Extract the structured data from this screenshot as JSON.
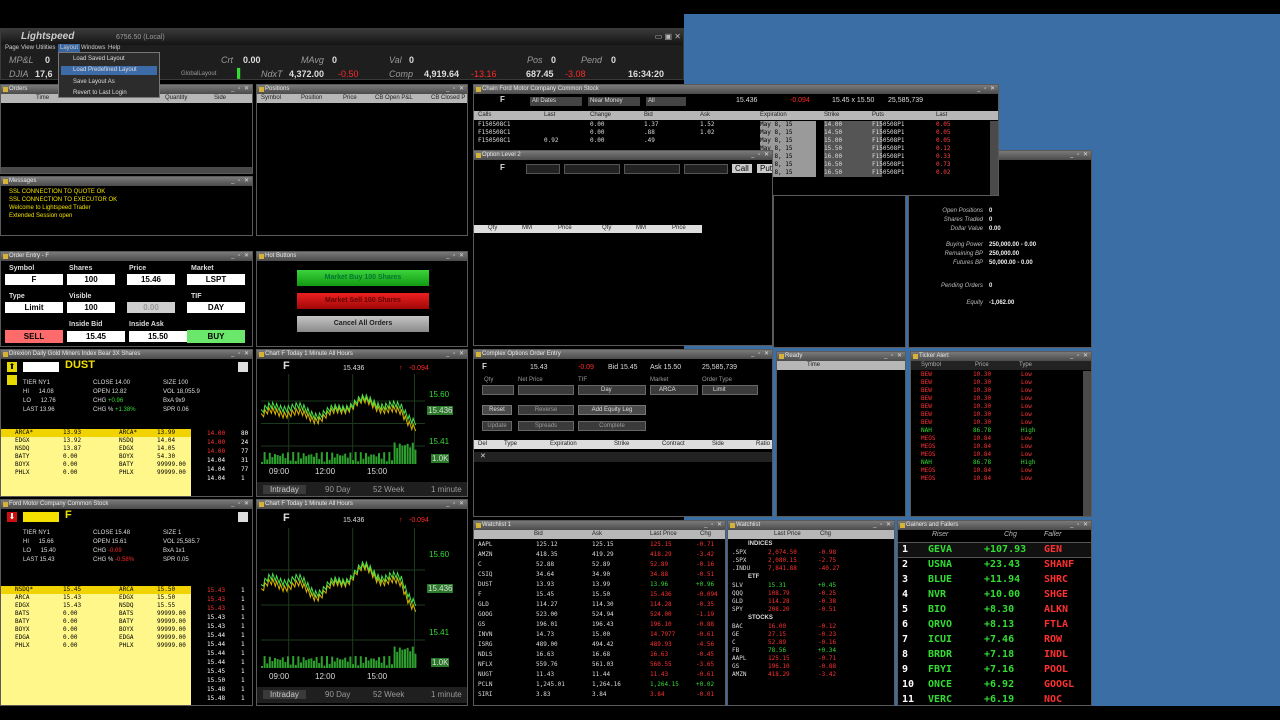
{
  "main": {
    "app_name": "Lightspeed",
    "account": "6756.50 (Local)",
    "menu": [
      "Page",
      "View",
      "Utilities",
      "Layout",
      "Windows",
      "Help"
    ],
    "layout_menu": [
      "Load Saved Layout",
      "Load Predefined Layout",
      "Save Layout As",
      "Revert to Last Login"
    ],
    "stats_row1": [
      {
        "label": "MP&L",
        "value": "0"
      },
      {
        "label": "Crt",
        "value": "0.00"
      },
      {
        "label": "MAvg",
        "value": "0"
      },
      {
        "label": "Val",
        "value": "0"
      },
      {
        "label": "Pos",
        "value": "0"
      },
      {
        "label": "Pend",
        "value": "0"
      }
    ],
    "stats_row2": {
      "dji_label": "DJIA",
      "dji_value": "17,6",
      "layout_label": "GlobalLayout",
      "nasdaq_label": "NdxT",
      "nasdaq_value": "4,372.00",
      "nasdaq_chg": "-0.50",
      "comp_label": "Comp",
      "comp_value": "4,919.64",
      "comp_chg": "-13.16",
      "val2": "687.45",
      "val2_chg": "-3.08",
      "clock": "16:34:20"
    }
  },
  "orders": {
    "title": "Orders",
    "cols": [
      "Time",
      "Quantity",
      "Side"
    ]
  },
  "positions": {
    "title": "Positions",
    "cols": [
      "Symbol",
      "Position",
      "Price",
      "CB Open P&L",
      "CB Closed P"
    ]
  },
  "messages": {
    "title": "Messages",
    "lines": [
      "SSL CONNECTION TO QUOTE OK",
      "SSL CONNECTION TO EXECUTOR OK",
      "Welcome to Lightspeed Trader",
      "Extended Session open"
    ]
  },
  "order_entry": {
    "title": "Order Entry - F",
    "labels": {
      "symbol": "Symbol",
      "shares": "Shares",
      "price": "Price",
      "market": "Market",
      "type": "Type",
      "visible": "Visible",
      "tif": "TIF",
      "inside_bid": "Inside Bid",
      "inside_ask": "Inside Ask"
    },
    "symbol": "F",
    "shares": "100",
    "price": "15.46",
    "market": "LSPT",
    "type": "Limit",
    "visible": "100",
    "stop": "0.00",
    "tif": "DAY",
    "bid": "15.45",
    "ask": "15.50",
    "sell": "SELL",
    "buy": "BUY"
  },
  "hot_buttons": {
    "title": "Hot Buttons",
    "b1": "Market Buy 100 Shares",
    "b2": "Market Sell 100 Shares",
    "b3": "Cancel All Orders"
  },
  "option_chain": {
    "title": "Chain Ford Motor Company Common Stock",
    "symbol": "F",
    "dates": "All Dates",
    "moneyness": "Near Money",
    "all": "All",
    "price": "15.436",
    "chg": "-0.094",
    "bidask": "15.45 x 15.50",
    "vol": "25,585,739",
    "cols": [
      "Calls",
      "Last",
      "Change",
      "Bid",
      "Ask",
      "Expiration",
      "Strike",
      "Puts",
      "Last"
    ],
    "rows": [
      [
        "F150508C1",
        "",
        "0.00",
        "1.37",
        "1.52",
        "May 8, 15",
        "14.00",
        "F150508P1",
        "0.05"
      ],
      [
        "F150508C1",
        "",
        "0.00",
        ".88",
        "1.02",
        "May 8, 15",
        "14.50",
        "F150508P1",
        "0.05"
      ],
      [
        "F150508C1",
        "0.92",
        "0.00",
        ".49",
        "",
        "May 8, 15",
        "15.00",
        "F150508P1",
        "0.05"
      ],
      [
        "",
        "",
        "",
        "",
        "",
        "May 8, 15",
        "15.50",
        "F150508P1",
        "0.12"
      ],
      [
        "",
        "",
        "",
        "",
        "",
        "May 8, 15",
        "16.00",
        "F150508P1",
        "0.33"
      ],
      [
        "",
        "",
        "",
        "",
        "",
        "May 8, 15",
        "16.50",
        "F150508P1",
        "0.73"
      ],
      [
        "",
        "",
        "",
        "",
        "",
        "May 8, 15",
        "16.50",
        "F150508P1",
        "0.02"
      ]
    ]
  },
  "option_level2": {
    "title": "Option Level 2",
    "sym": "F",
    "btns": [
      "Call",
      "Put"
    ],
    "cols": [
      "Qty",
      "MM",
      "Price",
      "Qty",
      "MM",
      "Price"
    ]
  },
  "account": {
    "rows": [
      {
        "l": "Open Positions",
        "v": "0"
      },
      {
        "l": "Shares Traded",
        "v": "0"
      },
      {
        "l": "Dollar Value",
        "v": "0.00"
      },
      {
        "l": "Buying Power",
        "v": "250,000.00 - 0.00"
      },
      {
        "l": "Remaining BP",
        "v": "250,000.00"
      },
      {
        "l": "Futures BP",
        "v": "50,000.00 - 0.00"
      },
      {
        "l": "Pending Orders",
        "v": "0"
      },
      {
        "l": "Equity",
        "v": "-1,062.00"
      }
    ]
  },
  "l2_dust": {
    "title": "Direxion Daily Gold Miners Index Bear 3X Shares",
    "symbol": "DUST",
    "tier": "NY1",
    "close": "14.00",
    "size": "100",
    "hi": "14.08",
    "open": "12.82",
    "vol": "18,055.9",
    "lo": "12.76",
    "chg": "+0.96",
    "bid": "9x9",
    "last": "13.96",
    "chgpct": "+1.38%",
    "spr": "0.06",
    "bids": [
      [
        "ARCA*",
        "13.93",
        "ARCA*",
        "13.99"
      ],
      [
        "EDGX",
        "13.92",
        "NSDQ",
        "14.04"
      ],
      [
        "NSDQ",
        "13.87",
        "EDGX",
        "14.05"
      ],
      [
        "BATY",
        "0.00",
        "BOYX",
        "54.30"
      ],
      [
        "BOYX",
        "0.00",
        "BATY",
        "99999.00"
      ],
      [
        "PHLX",
        "0.00",
        "PHLX",
        "99999.00"
      ]
    ],
    "prints": [
      [
        "14.00",
        "80"
      ],
      [
        "14.00",
        "24"
      ],
      [
        "14.00",
        "77"
      ],
      [
        "14.04",
        "31"
      ],
      [
        "14.04",
        "77"
      ],
      [
        "14.04",
        "1"
      ]
    ]
  },
  "l2_f": {
    "title": "Ford Motor Company Common Stock",
    "symbol": "F",
    "tier": "NY1",
    "close": "15.48",
    "size": "1",
    "hi": "15.66",
    "open": "15.61",
    "vol": "25,585.7",
    "lo": "15.40",
    "chg": "-0.09",
    "bid": "1x1",
    "last": "15.43",
    "chgpct": "-0.58%",
    "spr": "0.05",
    "bids": [
      [
        "NSDQ*",
        "15.45",
        "ARCA",
        "15.50"
      ],
      [
        "ARCA",
        "15.43",
        "EDGX",
        "15.50"
      ],
      [
        "EDGX",
        "15.43",
        "NSDQ",
        "15.55"
      ],
      [
        "BATS",
        "0.00",
        "BATS",
        "99999.00"
      ],
      [
        "BATY",
        "0.00",
        "BATY",
        "99999.00"
      ],
      [
        "BOYX",
        "0.00",
        "BOYX",
        "99999.00"
      ],
      [
        "EDGA",
        "0.00",
        "EDGA",
        "99999.00"
      ],
      [
        "PHLX",
        "0.00",
        "PHLX",
        "99999.00"
      ]
    ],
    "prints": [
      [
        "15.43",
        "1"
      ],
      [
        "15.43",
        "1"
      ],
      [
        "15.43",
        "1"
      ],
      [
        "15.43",
        "1"
      ],
      [
        "15.43",
        "1"
      ],
      [
        "15.44",
        "1"
      ],
      [
        "15.44",
        "1"
      ],
      [
        "15.44",
        "1"
      ],
      [
        "15.44",
        "1"
      ],
      [
        "15.45",
        "1"
      ],
      [
        "15.50",
        "1"
      ],
      [
        "15.48",
        "1"
      ],
      [
        "15.48",
        "1"
      ]
    ]
  },
  "chart1": {
    "title": "Chart F Today 1 Minute All Hours",
    "symbol": "F",
    "price": "15.436",
    "chg": "-0.094",
    "y_top": "15.60",
    "y_mid": "15.436",
    "y_bot": "15.41",
    "vol_label": "1.0K",
    "x": [
      "09:00",
      "12:00",
      "15:00"
    ],
    "tabs": [
      "Intraday",
      "90 Day",
      "52 Week",
      "1 minute"
    ]
  },
  "chart2": {
    "title": "Chart F Today 1 Minute All Hours",
    "symbol": "F",
    "price": "15.436",
    "chg": "-0.094",
    "y_top": "15.60",
    "y_mid": "15.436",
    "y_bot": "15.41",
    "vol_label": "1.0K",
    "x": [
      "09:00",
      "12:00",
      "15:00"
    ],
    "tabs": [
      "Intraday",
      "90 Day",
      "52 Week",
      "1 minute"
    ]
  },
  "complex_order": {
    "title": "Complex Options Order Entry",
    "symbol": "F",
    "price": "15.43",
    "chg": "-0.09",
    "bid": "15.45",
    "ask": "15.50",
    "vol": "25,585,739",
    "labels": [
      "Qty",
      "Net Price",
      "TIF",
      "Market",
      "Order Type"
    ],
    "tif": "Day",
    "market": "ARCA",
    "otype": "Limit",
    "btns": [
      "Reset",
      "Reverse",
      "Add Equity Leg",
      "Update",
      "Spreads",
      "Complete"
    ],
    "cols": [
      "Del",
      "Type",
      "Expiration",
      "Strike",
      "Contract",
      "Side",
      "Ratio"
    ]
  },
  "ready": {
    "title": "Ready",
    "col": "Time"
  },
  "ticker_alert": {
    "title": "Ticker Alert",
    "cols": [
      "Symbol",
      "Price",
      "Type"
    ],
    "rows": [
      [
        "BEW",
        "10.30",
        "Low"
      ],
      [
        "BEW",
        "10.30",
        "Low"
      ],
      [
        "BEW",
        "10.30",
        "Low"
      ],
      [
        "BEW",
        "10.30",
        "Low"
      ],
      [
        "BEW",
        "10.30",
        "Low"
      ],
      [
        "BEW",
        "10.30",
        "Low"
      ],
      [
        "BEW",
        "10.30",
        "Low"
      ],
      [
        "NAH",
        "86.78",
        "High"
      ],
      [
        "MEOS",
        "10.84",
        "Low"
      ],
      [
        "MEOS",
        "10.84",
        "Low"
      ],
      [
        "MEOS",
        "10.84",
        "Low"
      ],
      [
        "NAH",
        "86.78",
        "High"
      ],
      [
        "MEOS",
        "10.84",
        "Low"
      ],
      [
        "MEOS",
        "10.84",
        "Low"
      ]
    ]
  },
  "watchlist": {
    "title": "Watchlist 1",
    "cols": [
      "",
      "Bid",
      "Ask",
      "Last Price",
      "Chg"
    ],
    "rows": [
      [
        "AAPL",
        "125.12",
        "125.15",
        "125.15",
        "-0.71"
      ],
      [
        "AMZN",
        "418.35",
        "419.29",
        "418.29",
        "-3.42"
      ],
      [
        "C",
        "52.88",
        "52.89",
        "52.89",
        "-0.16"
      ],
      [
        "CSIQ",
        "34.64",
        "34.90",
        "34.88",
        "-0.51"
      ],
      [
        "DUST",
        "13.93",
        "13.99",
        "13.96",
        "+0.96"
      ],
      [
        "F",
        "15.45",
        "15.50",
        "15.436",
        "-0.094"
      ],
      [
        "GLD",
        "114.27",
        "114.30",
        "114.28",
        "-0.35"
      ],
      [
        "GOOG",
        "523.00",
        "524.94",
        "524.00",
        "-1.19"
      ],
      [
        "GS",
        "196.01",
        "196.43",
        "196.10",
        "-0.88"
      ],
      [
        "INVN",
        "14.73",
        "15.00",
        "14.7977",
        "-0.61"
      ],
      [
        "ISRG",
        "489.00",
        "494.42",
        "489.93",
        "-4.56"
      ],
      [
        "NDLS",
        "16.63",
        "16.68",
        "16.63",
        "-0.45"
      ],
      [
        "NFLX",
        "559.76",
        "561.03",
        "560.55",
        "-3.65"
      ],
      [
        "NUGT",
        "11.43",
        "11.44",
        "11.43",
        "-0.61"
      ],
      [
        "PCLN",
        "1,245.01",
        "1,264.16",
        "1,264.15",
        "+0.02"
      ],
      [
        "SIRI",
        "3.83",
        "3.84",
        "3.84",
        "-0.01"
      ]
    ]
  },
  "watchlist2": {
    "title": "Watchlist",
    "cols": [
      "",
      "Last Price",
      "Chg"
    ],
    "sections": [
      "INDICES",
      "ETF",
      "STOCKS"
    ],
    "idx": [
      [
        ".SPX",
        "2,074.50",
        "-0.98"
      ],
      [
        ".SPX",
        "2,080.15",
        "-2.75"
      ],
      [
        ".INDU",
        "7,841.88",
        "-40.27"
      ]
    ],
    "etf": [
      [
        "SLV",
        "15.31",
        "+0.45"
      ],
      [
        "QQQ",
        "108.79",
        "-0.25"
      ],
      [
        "GLD",
        "114.28",
        "-0.38"
      ],
      [
        "SPY",
        "208.20",
        "-0.51"
      ]
    ],
    "stk": [
      [
        "BAC",
        "16.00",
        "-0.12"
      ],
      [
        "GE",
        "27.15",
        "-0.23"
      ],
      [
        "C",
        "52.89",
        "-0.16"
      ],
      [
        "FB",
        "78.56",
        "+0.34"
      ],
      [
        "AAPL",
        "125.15",
        "-0.71"
      ],
      [
        "GS",
        "196.10",
        "-0.88"
      ],
      [
        "AMZN",
        "418.29",
        "-3.42"
      ]
    ]
  },
  "gainers": {
    "title": "Gainers and Fallers",
    "cols": [
      "Riser",
      "Chg",
      "Faller"
    ],
    "rows": [
      [
        "1",
        "GEVA",
        "+107.93",
        "GEN"
      ],
      [
        "2",
        "USNA",
        "+23.43",
        "SHANF"
      ],
      [
        "3",
        "BLUE",
        "+11.94",
        "SHRC"
      ],
      [
        "4",
        "NVR",
        "+10.00",
        "SHGE"
      ],
      [
        "5",
        "BIO",
        "+8.30",
        "ALKN"
      ],
      [
        "6",
        "QRVO",
        "+8.13",
        "FTLA"
      ],
      [
        "7",
        "ICUI",
        "+7.46",
        "ROW"
      ],
      [
        "8",
        "BRDR",
        "+7.18",
        "INDL"
      ],
      [
        "9",
        "FBYI",
        "+7.16",
        "POOL"
      ],
      [
        "10",
        "ONCE",
        "+6.92",
        "GOOGL"
      ],
      [
        "11",
        "VERC",
        "+6.19",
        "NOC"
      ]
    ]
  }
}
